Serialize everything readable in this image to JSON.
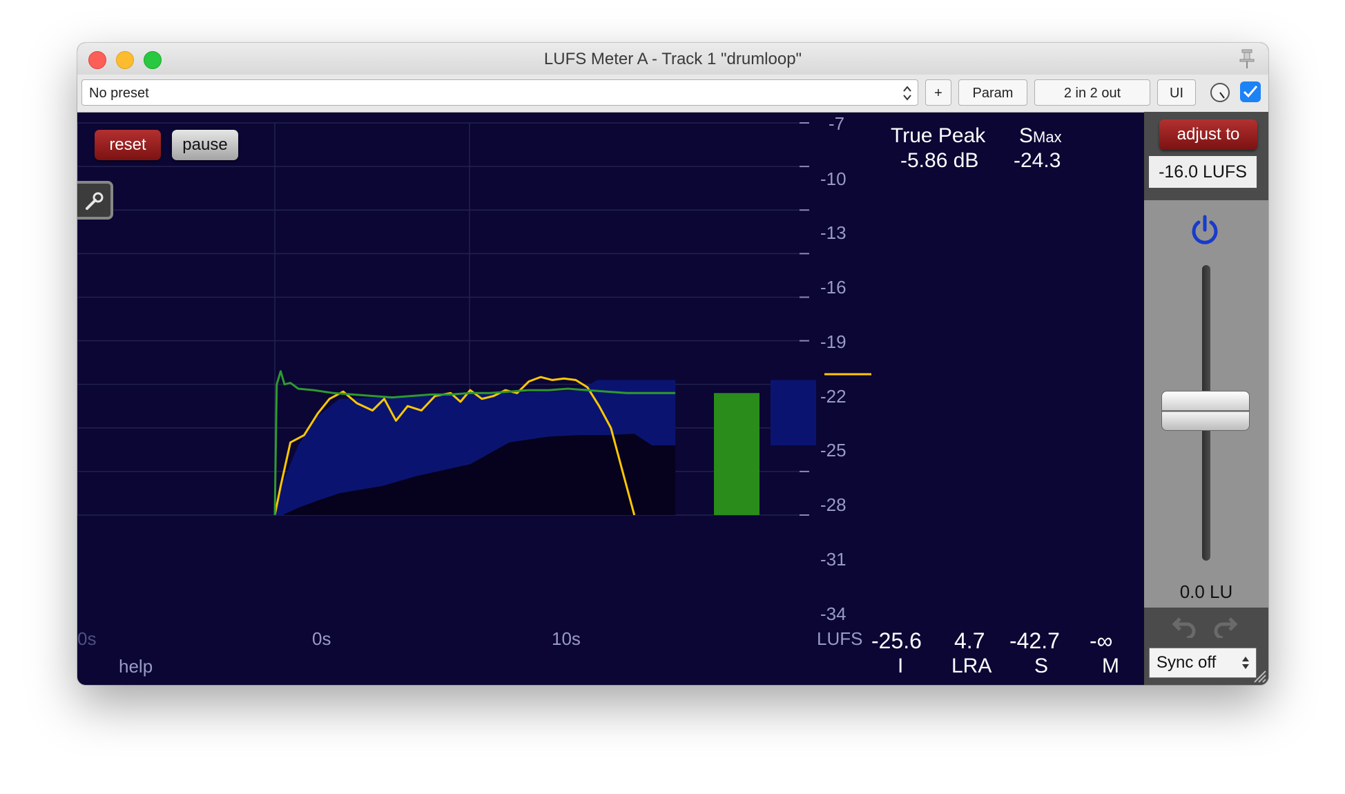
{
  "window": {
    "title": "LUFS Meter A - Track 1 \"drumloop\""
  },
  "toolbar": {
    "preset": "No preset",
    "add": "+",
    "param": "Param",
    "io": "2 in 2 out",
    "ui": "UI"
  },
  "buttons": {
    "reset": "reset",
    "pause": "pause"
  },
  "graph": {
    "y_ticks": [
      "-7",
      "-10",
      "-13",
      "-16",
      "-19",
      "-22",
      "-25",
      "-28",
      "-31",
      "-34"
    ],
    "x_ticks": [
      "0s",
      "0s",
      "10s"
    ],
    "unit": "LUFS",
    "help": "help",
    "colors": {
      "short_term": "#ffc800",
      "integrated": "#2e9a2e",
      "range_fill": "#0a1470",
      "background": "#0b0634"
    }
  },
  "readouts": {
    "true_peak_label": "True Peak",
    "true_peak_value": "-5.86 dB",
    "smax_label": "S",
    "smax_sub": "Max",
    "smax_value": "-24.3"
  },
  "meters": [
    {
      "value": "-25.6",
      "label": "I"
    },
    {
      "value": "4.7",
      "label": "LRA"
    },
    {
      "value": "-42.7",
      "label": "S"
    },
    {
      "value": "-∞",
      "label": "M"
    }
  ],
  "sidebar": {
    "adjust_label": "adjust to",
    "target": "-16.0 LUFS",
    "lu": "0.0 LU",
    "sync": "Sync off",
    "colors": {
      "power": "#1a3acc",
      "adjust": "#9a1f1f"
    }
  },
  "chart_data": {
    "type": "line",
    "ylim": [
      -34,
      -7
    ],
    "y_ticks": [
      -7,
      -10,
      -13,
      -16,
      -19,
      -22,
      -25,
      -28,
      -31,
      -34
    ],
    "x_ticks": [
      "0s",
      "0s",
      "10s"
    ],
    "ylabel": "LUFS",
    "series": [
      {
        "color": "#ffc800",
        "x": [
          0.0,
          0.3,
          0.8,
          1.5,
          2.2,
          2.8,
          3.5,
          4.2,
          5.0,
          5.6,
          6.2,
          6.8,
          7.5,
          8.2,
          9.0,
          9.5,
          10.0,
          10.6,
          11.2,
          11.8,
          12.4,
          13.0,
          13.6,
          14.2,
          14.8,
          15.4,
          16.0,
          16.6,
          17.2,
          17.8,
          18.4
        ],
        "y": [
          -34.0,
          -32.0,
          -29.0,
          -28.5,
          -27.0,
          -26.0,
          -25.5,
          -26.3,
          -26.8,
          -26.0,
          -27.5,
          -26.5,
          -26.8,
          -25.8,
          -25.6,
          -26.2,
          -25.4,
          -26.0,
          -25.8,
          -25.4,
          -25.6,
          -24.8,
          -24.5,
          -24.7,
          -24.6,
          -24.7,
          -25.2,
          -26.5,
          -28.0,
          -31.0,
          -34.0
        ]
      },
      {
        "color": "#2e9a2e",
        "x": [
          0.0,
          0.1,
          0.3,
          0.5,
          0.8,
          1.2,
          2.0,
          3.0,
          4.0,
          5.0,
          6.0,
          7.0,
          8.0,
          9.0,
          10.0,
          11.0,
          12.0,
          13.0,
          14.0,
          15.0,
          16.0,
          17.0,
          18.0,
          19.0,
          20.0,
          20.5
        ],
        "y": [
          -34.0,
          -25.0,
          -24.1,
          -25.0,
          -24.9,
          -25.3,
          -25.4,
          -25.6,
          -25.7,
          -25.8,
          -25.9,
          -25.8,
          -25.7,
          -25.7,
          -25.6,
          -25.6,
          -25.5,
          -25.4,
          -25.4,
          -25.3,
          -25.4,
          -25.5,
          -25.6,
          -25.6,
          -25.6,
          -25.6
        ]
      }
    ],
    "range_upper": {
      "x": [
        0.0,
        0.4,
        1.2,
        2.2,
        3.3,
        5.5,
        8.0,
        10.0,
        12.0,
        14.0,
        15.6,
        16.5,
        17.3,
        18.4,
        20.5
      ],
      "y": [
        -34.0,
        -31.8,
        -29.2,
        -27.2,
        -26.0,
        -25.9,
        -25.8,
        -25.7,
        -25.6,
        -25.5,
        -25.4,
        -24.7,
        -24.7,
        -24.7,
        -24.7
      ]
    },
    "range_lower": {
      "x": [
        0.0,
        0.4,
        1.2,
        2.2,
        3.3,
        5.5,
        7.3,
        10.0,
        12.0,
        14.0,
        15.6,
        17.0,
        18.4,
        19.3,
        20.5
      ],
      "y": [
        -34.0,
        -34.0,
        -33.5,
        -33.0,
        -32.5,
        -32.0,
        -31.3,
        -30.5,
        -29.0,
        -28.6,
        -28.5,
        -28.5,
        -28.4,
        -29.2,
        -29.2
      ]
    },
    "meter_bars": [
      {
        "label": "I",
        "value": -25.6,
        "color": "#2a8c1a"
      },
      {
        "label": "LRA",
        "low": -29.2,
        "high": -24.7,
        "color": "#0a1470"
      }
    ],
    "smax_marker": -24.3
  }
}
